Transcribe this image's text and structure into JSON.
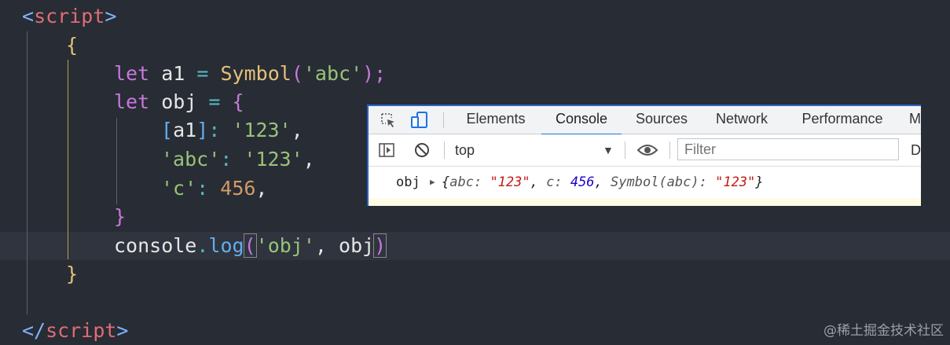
{
  "editor": {
    "lines": [
      {
        "tokens": [
          {
            "t": "<",
            "c": "t-punct"
          },
          {
            "t": "script",
            "c": "t-tag"
          },
          {
            "t": ">",
            "c": "t-punct"
          }
        ]
      },
      {
        "tokens": [
          {
            "t": "{",
            "c": "t-brace"
          }
        ]
      },
      {
        "tokens": [
          {
            "t": "let ",
            "c": "t-kw"
          },
          {
            "t": "a1",
            "c": "t-var"
          },
          {
            "t": " = ",
            "c": "t-op"
          },
          {
            "t": "Symbol",
            "c": "t-fn"
          },
          {
            "t": "(",
            "c": "t-kw"
          },
          {
            "t": "'abc'",
            "c": "t-str"
          },
          {
            "t": ");",
            "c": "t-kw"
          }
        ]
      },
      {
        "tokens": [
          {
            "t": "let ",
            "c": "t-kw"
          },
          {
            "t": "obj",
            "c": "t-var"
          },
          {
            "t": " = ",
            "c": "t-op"
          },
          {
            "t": "{",
            "c": "t-kw"
          }
        ]
      },
      {
        "tokens": [
          {
            "t": "[",
            "c": "t-method"
          },
          {
            "t": "a1",
            "c": "t-var"
          },
          {
            "t": "]",
            "c": "t-method"
          },
          {
            "t": ": ",
            "c": "t-op"
          },
          {
            "t": "'123'",
            "c": "t-str"
          },
          {
            "t": ",",
            "c": "t-var"
          }
        ]
      },
      {
        "tokens": [
          {
            "t": "'abc'",
            "c": "t-str"
          },
          {
            "t": ": ",
            "c": "t-op"
          },
          {
            "t": "'123'",
            "c": "t-str"
          },
          {
            "t": ",",
            "c": "t-var"
          }
        ]
      },
      {
        "tokens": [
          {
            "t": "'c'",
            "c": "t-str"
          },
          {
            "t": ": ",
            "c": "t-op"
          },
          {
            "t": "456",
            "c": "t-num"
          },
          {
            "t": ",",
            "c": "t-var"
          }
        ]
      },
      {
        "tokens": [
          {
            "t": "}",
            "c": "t-kw"
          }
        ]
      },
      {
        "tokens": [
          {
            "t": "console",
            "c": "t-var"
          },
          {
            "t": ".",
            "c": "t-op"
          },
          {
            "t": "log",
            "c": "t-method"
          },
          {
            "t": "(",
            "c": "t-kw t-paren-hl"
          },
          {
            "t": "'obj'",
            "c": "t-str"
          },
          {
            "t": ", ",
            "c": "t-var"
          },
          {
            "t": "obj",
            "c": "t-var"
          },
          {
            "t": ")",
            "c": "t-kw t-paren-hl"
          }
        ]
      },
      {
        "tokens": [
          {
            "t": "}",
            "c": "t-brace"
          }
        ]
      },
      {
        "tokens": []
      },
      {
        "tokens": [
          {
            "t": "</",
            "c": "t-punct"
          },
          {
            "t": "script",
            "c": "t-tag"
          },
          {
            "t": ">",
            "c": "t-punct"
          }
        ]
      }
    ]
  },
  "devtools": {
    "tabs": [
      "Elements",
      "Console",
      "Sources",
      "Network",
      "Performance"
    ],
    "active_tab": "Console",
    "clipped_tab": "M",
    "context": "top",
    "filter_placeholder": "Filter",
    "clipped_toolbar": "D",
    "log": {
      "label": "obj",
      "open": "{",
      "k1": "abc: ",
      "v1": "\"123\"",
      "sep1": ", ",
      "k2": "c: ",
      "v2": "456",
      "sep2": ", ",
      "k3": "Symbol(abc): ",
      "v3": "\"123\"",
      "close": "}"
    }
  },
  "watermark": "@稀土掘金技术社区"
}
